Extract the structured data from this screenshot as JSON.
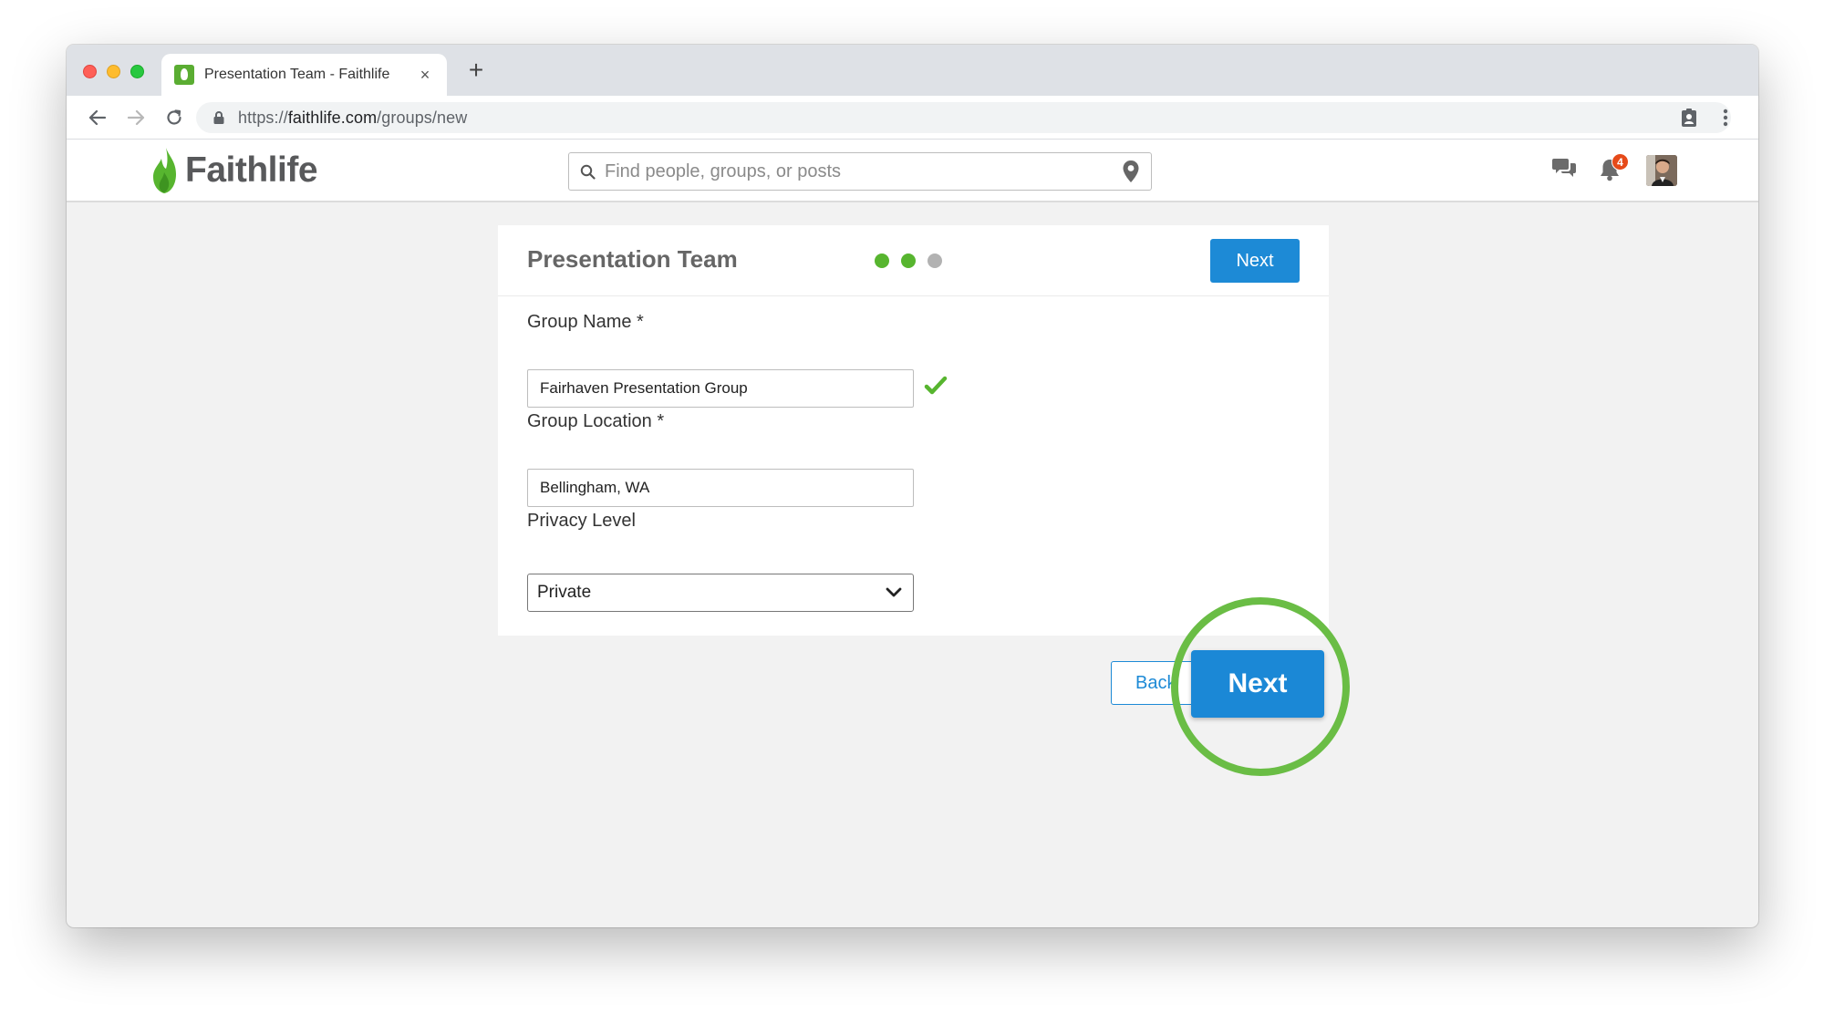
{
  "browser": {
    "tab_title": "Presentation Team - Faithlife",
    "tab_close": "×",
    "new_tab": "+",
    "url_prefix": "https://",
    "url_host": "faithlife.com",
    "url_path": "/groups/new"
  },
  "header": {
    "logo_text": "Faithlife",
    "search_placeholder": "Find people, groups, or posts",
    "notification_count": "4"
  },
  "card": {
    "title": "Presentation Team",
    "progress": {
      "current_step": 2,
      "total_steps": 3
    },
    "next_label": "Next"
  },
  "form": {
    "group_name_label": "Group Name *",
    "group_name_value": "Fairhaven Presentation Group",
    "group_location_label": "Group Location *",
    "group_location_value": "Bellingham, WA",
    "privacy_label": "Privacy Level",
    "privacy_value": "Private"
  },
  "footer_buttons": {
    "back_label": "Back",
    "next_label": "Next"
  },
  "colors": {
    "brand_green": "#57b52f",
    "primary_blue": "#1d8ad6",
    "highlight_ring": "#6abd45",
    "badge_red": "#e64a19"
  }
}
